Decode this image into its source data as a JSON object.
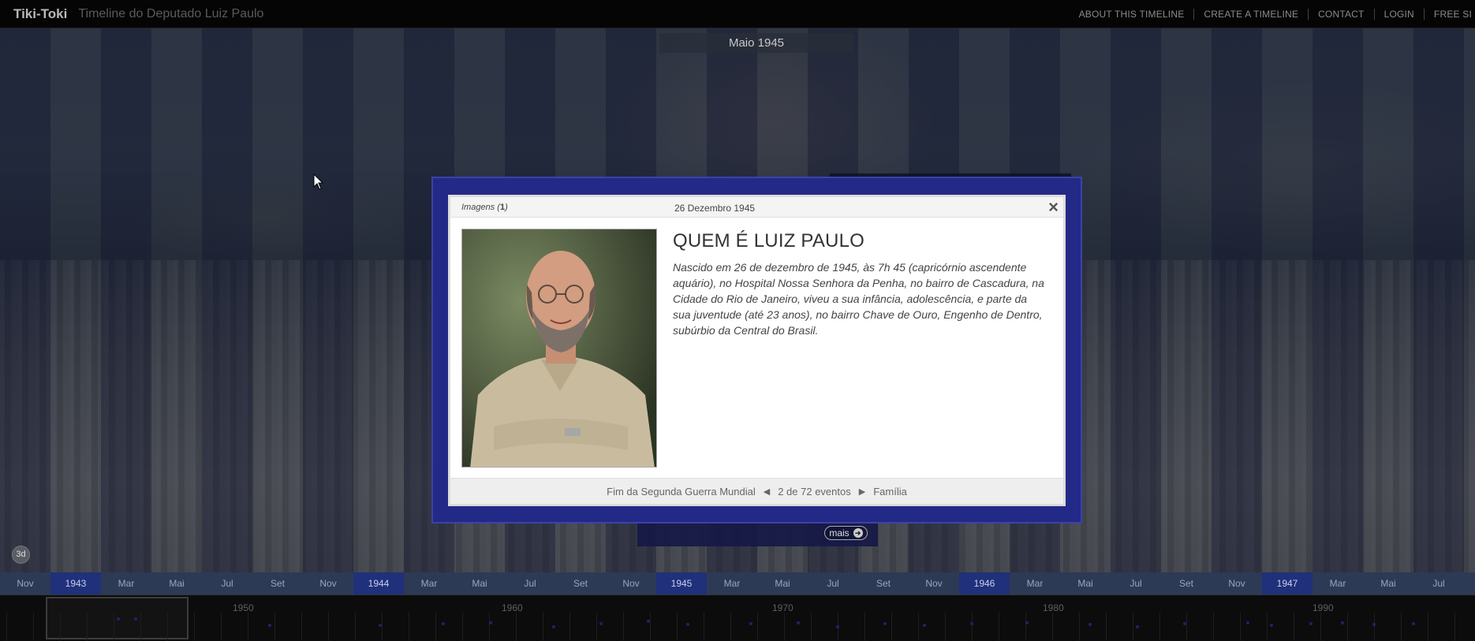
{
  "topbar": {
    "brand": "Tiki-Toki",
    "title": "Timeline do Deputado Luiz Paulo",
    "nav": [
      "ABOUT THIS TIMELINE",
      "CREATE A TIMELINE",
      "CONTACT",
      "LOGIN",
      "FREE SI"
    ]
  },
  "current_date": "Maio 1945",
  "btn_3d": "3d",
  "mais_label": "mais",
  "months": [
    {
      "label": "Nov",
      "year": false
    },
    {
      "label": "1943",
      "year": true
    },
    {
      "label": "Mar",
      "year": false
    },
    {
      "label": "Mai",
      "year": false
    },
    {
      "label": "Jul",
      "year": false
    },
    {
      "label": "Set",
      "year": false
    },
    {
      "label": "Nov",
      "year": false
    },
    {
      "label": "1944",
      "year": true
    },
    {
      "label": "Mar",
      "year": false
    },
    {
      "label": "Mai",
      "year": false
    },
    {
      "label": "Jul",
      "year": false
    },
    {
      "label": "Set",
      "year": false
    },
    {
      "label": "Nov",
      "year": false
    },
    {
      "label": "1945",
      "year": true
    },
    {
      "label": "Mar",
      "year": false
    },
    {
      "label": "Mai",
      "year": false
    },
    {
      "label": "Jul",
      "year": false
    },
    {
      "label": "Set",
      "year": false
    },
    {
      "label": "Nov",
      "year": false
    },
    {
      "label": "1946",
      "year": true
    },
    {
      "label": "Mar",
      "year": false
    },
    {
      "label": "Mai",
      "year": false
    },
    {
      "label": "Jul",
      "year": false
    },
    {
      "label": "Set",
      "year": false
    },
    {
      "label": "Nov",
      "year": false
    },
    {
      "label": "1947",
      "year": true
    },
    {
      "label": "Mar",
      "year": false
    },
    {
      "label": "Mai",
      "year": false
    },
    {
      "label": "Jul",
      "year": false
    }
  ],
  "overview": {
    "decades": [
      "1950",
      "1960",
      "1970",
      "1980",
      "1990"
    ]
  },
  "modal": {
    "images_label": "Imagens",
    "images_count": "1",
    "date": "26 Dezembro 1945",
    "title": "QUEM É LUIZ PAULO",
    "body": "Nascido em 26 de dezembro de 1945, às 7h 45 (capricórnio ascendente aquário), no Hospital Nossa Senhora da Penha, no bairro de Cascadura, na Cidade do Rio de Janeiro, viveu a sua infância, adolescência, e parte da sua juventude (até 23 anos), no bairro Chave de Ouro, Engenho de Dentro, subúrbio da Central do Brasil.",
    "prev_event": "Fim da Segunda Guerra Mundial",
    "position": "2 de 72 eventos",
    "next_event": "Família"
  }
}
